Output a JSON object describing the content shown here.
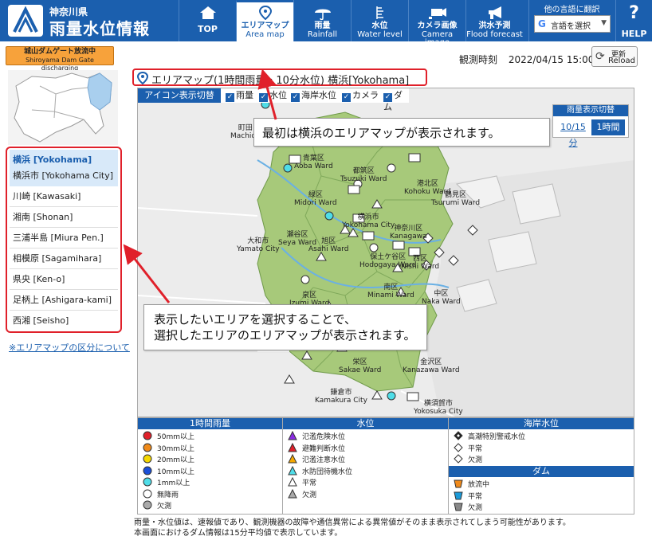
{
  "header": {
    "prefecture": "神奈川県",
    "site_title": "雨量水位情報",
    "nav": [
      {
        "ja": "TOP",
        "en": ""
      },
      {
        "ja": "エリアマップ",
        "en": "Area map"
      },
      {
        "ja": "雨量",
        "en": "Rainfall"
      },
      {
        "ja": "水位",
        "en": "Water level"
      },
      {
        "ja": "カメラ画像",
        "en": "Camera image"
      },
      {
        "ja": "洪水予測",
        "en": "Flood forecast"
      }
    ],
    "lang_label": "他の言語に翻訳",
    "lang_select": "言語を選択",
    "help": "HELP"
  },
  "dam_button": {
    "ja": "城山ダムゲート放流中",
    "en": "Shiroyama Dam Gate discharging"
  },
  "observation": {
    "label": "観測時刻",
    "time": "2022/04/15 15:00"
  },
  "reload": {
    "ja": "更新",
    "en": "Reload"
  },
  "sidebar": {
    "group_title": "横浜 [Yokohama]",
    "group_sub": "横浜市 [Yokohama City]",
    "areas": [
      "川崎 [Kawasaki]",
      "湘南 [Shonan]",
      "三浦半島 [Miura Pen.]",
      "相模原 [Sagamihara]",
      "県央 [Ken-o]",
      "足柄上 [Ashigara-kami]",
      "西湘 [Seisho]"
    ],
    "note_link": "※エリアマップの区分について"
  },
  "map": {
    "title": "エリアマップ(1時間雨量・10分水位) 横浜[Yokohama]",
    "icon_toggle_label": "アイコン表示切替",
    "checkboxes": [
      "雨量",
      "水位",
      "海岸水位",
      "カメラ",
      "ダム"
    ],
    "rain_toggle_title": "雨量表示切替",
    "rain_toggle_10": "10/15分",
    "rain_toggle_60": "1時間",
    "places": [
      {
        "ja": "町田",
        "en": "Machida"
      },
      {
        "ja": "青葉区",
        "en": "Aoba Ward"
      },
      {
        "ja": "都筑区",
        "en": "Tsuzuki Ward"
      },
      {
        "ja": "港北区",
        "en": "Kohoku Ward"
      },
      {
        "ja": "緑区",
        "en": "Midori Ward"
      },
      {
        "ja": "鶴見区",
        "en": "Tsurumi Ward"
      },
      {
        "ja": "横浜市",
        "en": "Yokohama City"
      },
      {
        "ja": "神奈川区",
        "en": "Kanagawa"
      },
      {
        "ja": "瀬谷区",
        "en": "Seya Ward"
      },
      {
        "ja": "大和市",
        "en": "Yamato City"
      },
      {
        "ja": "旭区",
        "en": "Asahi Ward"
      },
      {
        "ja": "保土ケ谷区",
        "en": "Hodogaya Ward"
      },
      {
        "ja": "西区",
        "en": "Nishi Ward"
      },
      {
        "ja": "南区",
        "en": "Minami Ward"
      },
      {
        "ja": "中区",
        "en": "Naka Ward"
      },
      {
        "ja": "泉区",
        "en": "Izumi Ward"
      },
      {
        "ja": "栄区",
        "en": "Sakae Ward"
      },
      {
        "ja": "金沢区",
        "en": "Kanazawa Ward"
      },
      {
        "ja": "鎌倉市",
        "en": "Kamakura City"
      },
      {
        "ja": "横須賀市",
        "en": "Yokosuka City"
      }
    ]
  },
  "callouts": {
    "top": "最初は横浜のエリアマップが表示されます。",
    "bottom_1": "表示したいエリアを選択することで、",
    "bottom_2": "選択したエリアのエリアマップが表示されます。"
  },
  "legend": {
    "rain_title": "1時間雨量",
    "rain_items": [
      "50mm以上",
      "30mm以上",
      "20mm以上",
      "10mm以上",
      "1mm以上",
      "無降雨",
      "欠測"
    ],
    "rain_colors": [
      "#e0202a",
      "#f08a1a",
      "#f5d800",
      "#1b4fd8",
      "#4fdde8",
      "#ffffff",
      "#aaaaaa"
    ],
    "water_title": "水位",
    "water_items": [
      "氾濫危険水位",
      "避難判断水位",
      "氾濫注意水位",
      "水防団待機水位",
      "平常",
      "欠測"
    ],
    "water_colors": [
      "#8a2be2",
      "#e0202a",
      "#f5a800",
      "#4fdde8",
      "#ffffff",
      "#aaaaaa"
    ],
    "coast_title": "海岸水位",
    "coast_items": [
      "高潮特別警戒水位",
      "平常",
      "欠測"
    ],
    "dam_title": "ダム",
    "dam_items": [
      "放流中",
      "平常",
      "欠測"
    ],
    "dam_colors": [
      "#f08a1a",
      "#1b9ad8",
      "#888888"
    ]
  },
  "footnote": {
    "line1": "雨量・水位値は、速報値であり、観測機器の故障や通信異常による異常値がそのまま表示されてしまう可能性があります。",
    "line2": "本画面におけるダム情報は15分平均値で表示しています。"
  },
  "colors": {
    "brand": "#1b5fae",
    "highlight": "#e0202a",
    "land": "#a7c97a"
  }
}
